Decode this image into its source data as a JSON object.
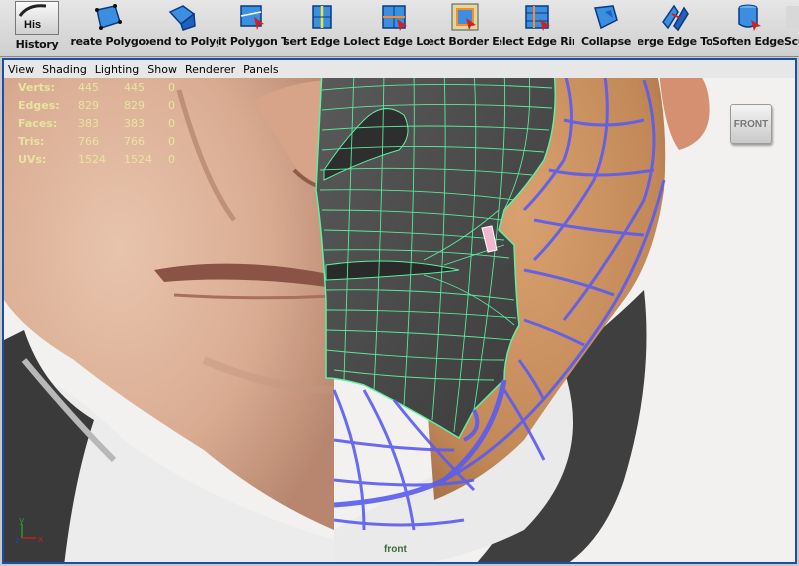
{
  "shelf": {
    "history": {
      "icon_text": "His",
      "label": "History"
    },
    "tools": [
      {
        "label": "Create Polygon",
        "icon": "create-polygon-icon"
      },
      {
        "label": "Append to Polygon",
        "icon": "append-polygon-icon"
      },
      {
        "label": "Split Polygon Tool",
        "icon": "split-polygon-icon"
      },
      {
        "label": "Insert Edge Loop",
        "icon": "insert-edge-loop-icon"
      },
      {
        "label": "Select Edge Loop",
        "icon": "select-edge-loop-icon"
      },
      {
        "label": "Select Border Edge",
        "icon": "select-border-icon"
      },
      {
        "label": "Select Edge Ring",
        "icon": "select-edge-ring-icon"
      },
      {
        "label": "Collapse",
        "icon": "collapse-icon"
      },
      {
        "label": "Merge Edge Tool",
        "icon": "merge-edge-icon"
      },
      {
        "label": "Soften Edge",
        "icon": "soften-edge-icon"
      },
      {
        "label": "Sculpt",
        "icon": "sculpt-icon"
      }
    ]
  },
  "panel_menu": [
    "View",
    "Shading",
    "Lighting",
    "Show",
    "Renderer",
    "Panels"
  ],
  "hud": [
    {
      "label": "Verts:",
      "v1": "445",
      "v2": "445",
      "v3": "0"
    },
    {
      "label": "Edges:",
      "v1": "829",
      "v2": "829",
      "v3": "0"
    },
    {
      "label": "Faces:",
      "v1": "383",
      "v2": "383",
      "v3": "0"
    },
    {
      "label": "Tris:",
      "v1": "766",
      "v2": "766",
      "v3": "0"
    },
    {
      "label": "UVs:",
      "v1": "1524",
      "v2": "1524",
      "v3": "0"
    }
  ],
  "view_cube": {
    "label": "FRONT"
  },
  "camera_name": "front",
  "axis": {
    "y": "y",
    "z": "z",
    "x": "x"
  },
  "colors": {
    "viewport_border": "#1a4fa8",
    "wire_green": "#5cf0a0",
    "wire_blue": "#5a5cf0",
    "mesh_gray": "#4e4e4e",
    "hud_text": "#e8e4a0"
  }
}
